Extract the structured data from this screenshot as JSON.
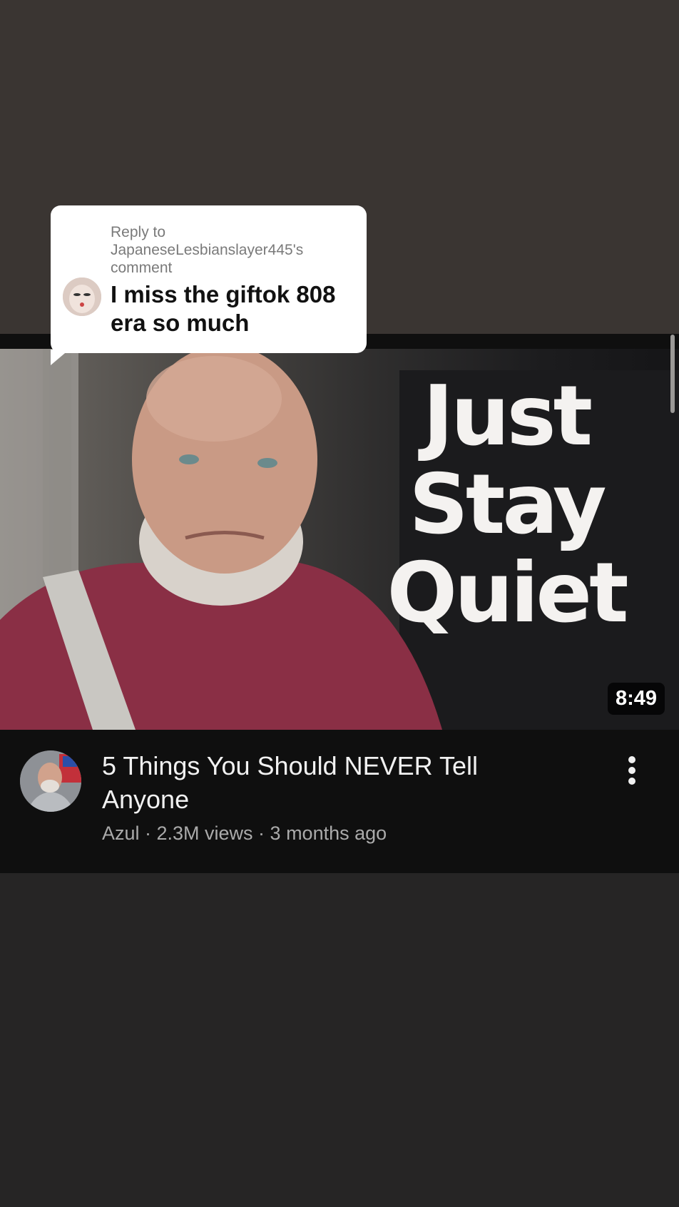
{
  "comment_reply": {
    "reply_label": "Reply to JapaneseLesbianslayer445's comment",
    "comment_text": "I miss the giftok 808 era so much"
  },
  "video": {
    "thumbnail_text": [
      "Just",
      "Stay",
      "Quiet"
    ],
    "duration": "8:49",
    "title": "5 Things You Should NEVER Tell Anyone",
    "meta": "Azul · 2.3M views · 3 months ago"
  },
  "icons": {
    "more": "more-vertical-icon"
  },
  "colors": {
    "background": "#262525",
    "top_background": "#3a3532",
    "card": "#0f0f0f",
    "title": "#f1f1f1",
    "meta": "#aaaaaa",
    "shirt": "#8a2f45"
  }
}
